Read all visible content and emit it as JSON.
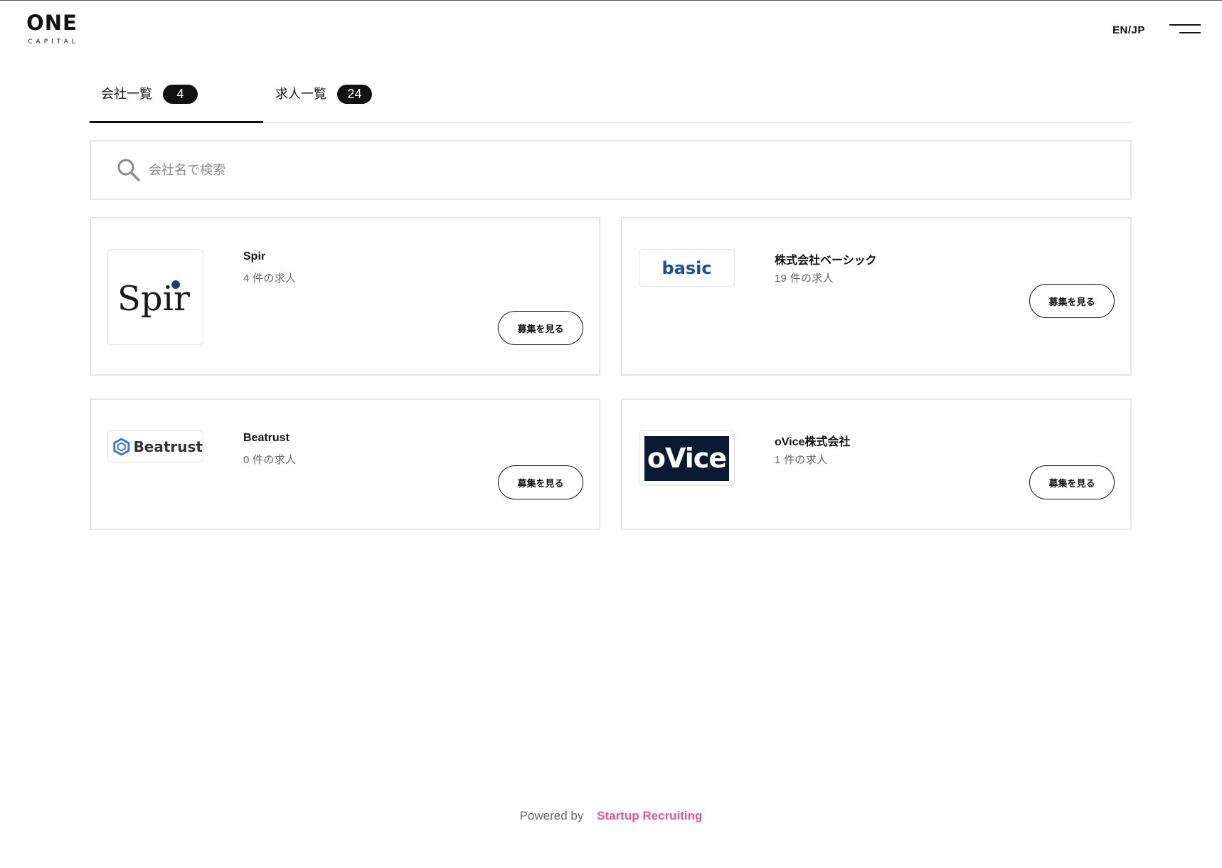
{
  "header": {
    "logo_main": "ONE",
    "logo_sub": "CAPITAL",
    "lang_toggle": "EN/JP"
  },
  "tabs": [
    {
      "label": "会社一覧",
      "count": "4",
      "active": true
    },
    {
      "label": "求人一覧",
      "count": "24",
      "active": false
    }
  ],
  "search": {
    "placeholder": "会社名で検索",
    "value": ""
  },
  "companies": [
    {
      "name": "Spir",
      "jobs": "4 件の求人",
      "button": "募集を見る",
      "logo_text": "Spir"
    },
    {
      "name": "株式会社ベーシック",
      "jobs": "19 件の求人",
      "button": "募集を見る",
      "logo_text": "basic"
    },
    {
      "name": "Beatrust",
      "jobs": "0 件の求人",
      "button": "募集を見る",
      "logo_text": "Beatrust"
    },
    {
      "name": "oVice株式会社",
      "jobs": "1 件の求人",
      "button": "募集を見る",
      "logo_text": "oVice"
    }
  ],
  "footer": {
    "prefix": "Powered by",
    "link": "Startup Recruiting"
  },
  "colors": {
    "accent": "#f0508a",
    "basic_blue": "#1d4f91",
    "beatrust_blue": "#2f6fe0",
    "ovice_navy": "#0b1a33"
  }
}
